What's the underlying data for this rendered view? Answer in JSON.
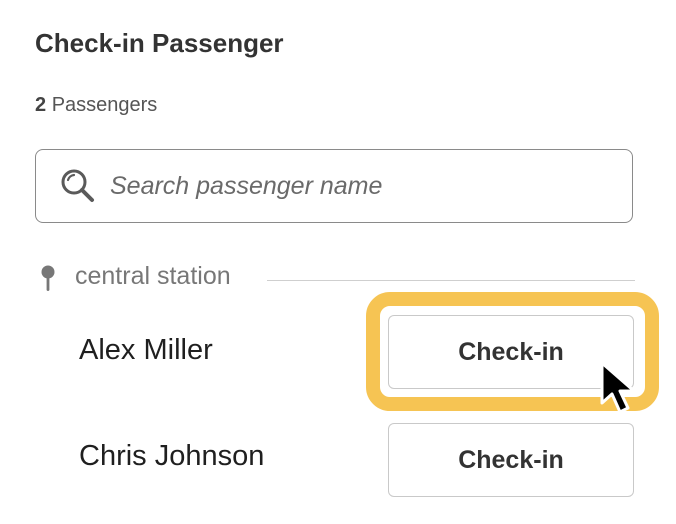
{
  "header": {
    "title": "Check-in Passenger",
    "passenger_count": "2",
    "passenger_count_suffix": "Passengers"
  },
  "search": {
    "icon": "search-icon",
    "placeholder": "Search passenger name",
    "value": ""
  },
  "station": {
    "icon": "map-pin-icon",
    "label": "central station"
  },
  "passengers": [
    {
      "name": "Alex Miller",
      "button_label": "Check-in",
      "highlighted": true
    },
    {
      "name": "Chris Johnson",
      "button_label": "Check-in",
      "highlighted": false
    }
  ],
  "colors": {
    "highlight": "#f6c453",
    "border": "#c9c9c9",
    "text": "#222222",
    "muted": "#777777"
  }
}
